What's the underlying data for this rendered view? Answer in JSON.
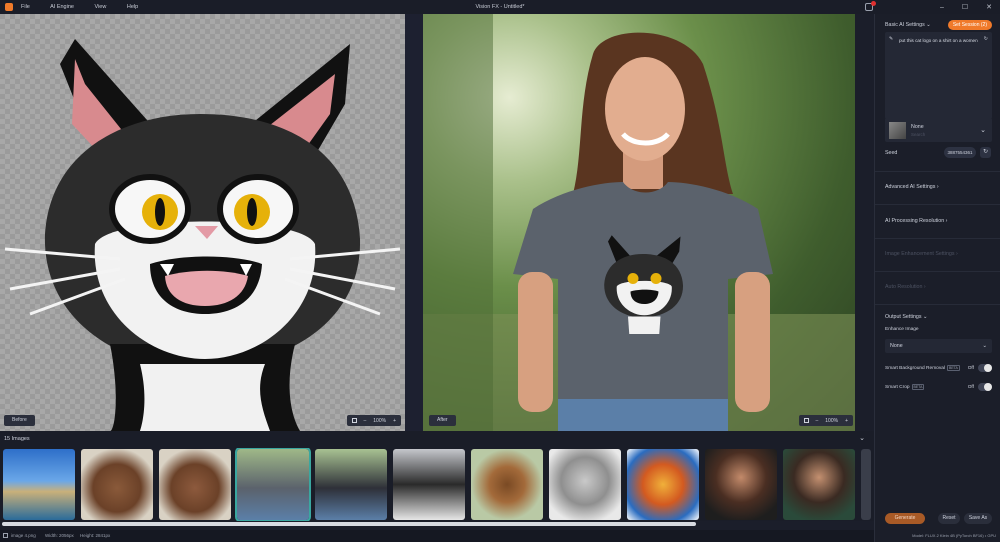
{
  "app": {
    "title": "Vision FX - Untitled*",
    "menu": [
      "File",
      "AI Engine",
      "View",
      "Help"
    ],
    "notification_count": "1"
  },
  "canvas": {
    "before_label": "Before",
    "after_label": "After",
    "zoom_left": "100%",
    "zoom_right": "100%"
  },
  "filmstrip": {
    "count_label": "15 Images"
  },
  "panel": {
    "basic_title": "Basic AI Settings",
    "set_session_btn": "Set Session (2)",
    "prompt": "put this cat logo on a shirt on a women",
    "model_name": "None",
    "model_sub": "Search",
    "seed_label": "Seed",
    "seed_value": "3887554361",
    "advanced": "Advanced AI Settings",
    "processing": "AI Processing Resolution",
    "image_enhance": "Image Enhancement Settings",
    "auto_resolution": "Auto Resolution",
    "output_title": "Output Settings",
    "enhance_label": "Enhance Image",
    "enhance_value": "None",
    "bg_removal": "Smart Background Removal",
    "bg_badge": "BETA",
    "bg_state": "Off",
    "smart_crop": "Smart Crop",
    "crop_badge": "BETA",
    "crop_state": "Off",
    "generate_btn": "Generate",
    "reset_btn": "Reset",
    "save_btn": "Save As"
  },
  "status": {
    "file": "image 4.png",
    "width": "Width: 2056px",
    "height": "Height: 2841px",
    "right": "Model: FLUX.2 Klein 4B (PyTorch BF16) • GPU"
  },
  "colors": {
    "accent": "#f07a2a",
    "selection": "#3aa7a0"
  }
}
